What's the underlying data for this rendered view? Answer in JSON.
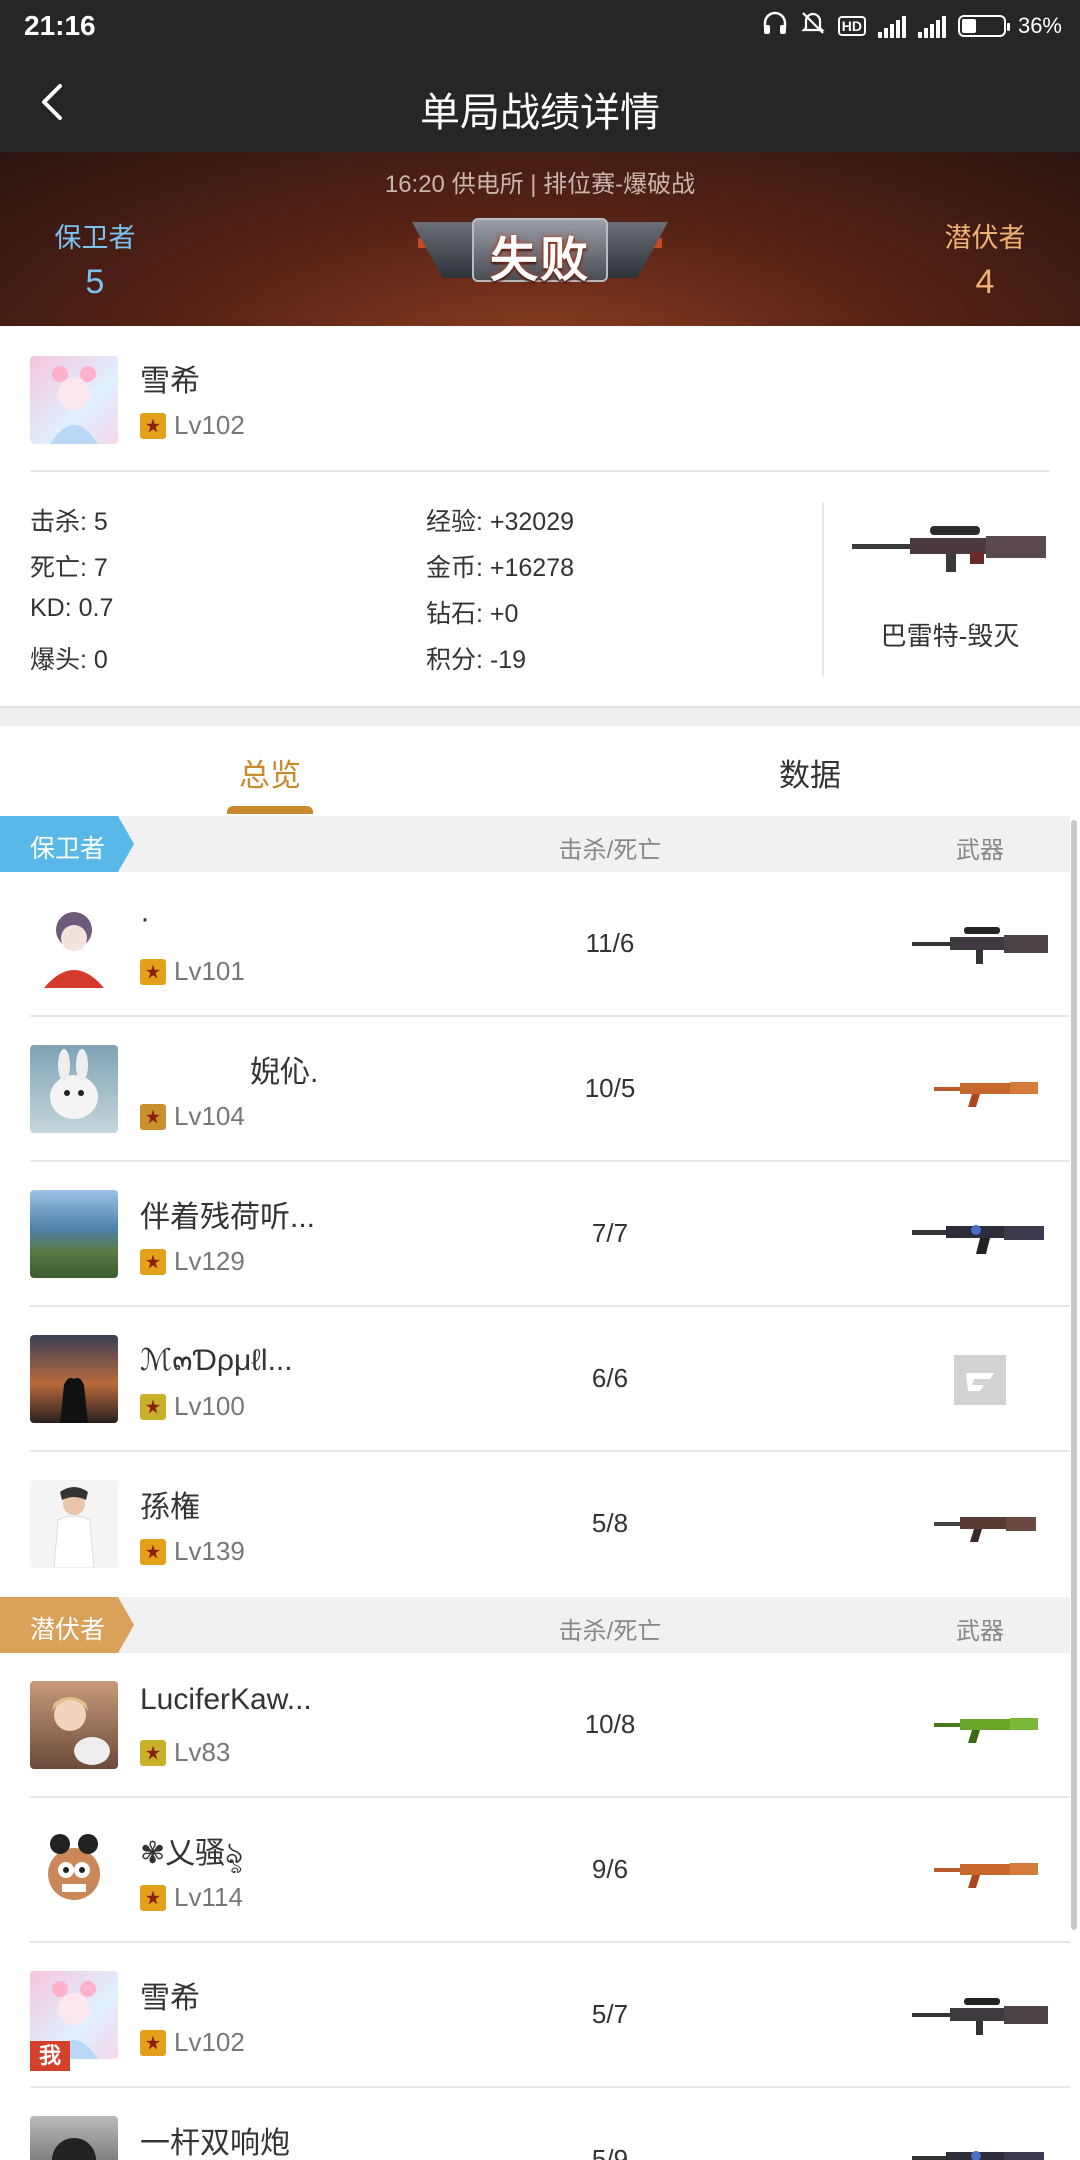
{
  "status_bar": {
    "time": "21:16",
    "network": "4G",
    "battery": "36%"
  },
  "header": {
    "title": "单局战绩详情"
  },
  "match": {
    "meta": "16:20 供电所 | 排位赛-爆破战",
    "result": "失败",
    "left_team": {
      "name": "保卫者",
      "score": "5"
    },
    "right_team": {
      "name": "潜伏者",
      "score": "4"
    }
  },
  "player": {
    "name": "雪希",
    "level": "Lv102",
    "stats": {
      "kills": "击杀: 5",
      "deaths": "死亡: 7",
      "kd": "KD: 0.7",
      "headshots": "爆头: 0",
      "exp": "经验: +32029",
      "gold": "金币: +16278",
      "diamond": "钻石: +0",
      "points": "积分: -19"
    },
    "weapon": "巴雷特-毁灭"
  },
  "tabs": [
    {
      "label": "总览"
    },
    {
      "label": "数据"
    }
  ],
  "sections": {
    "defenders": {
      "tag": "保卫者",
      "col_kd": "击杀/死亡",
      "col_weapon": "武器",
      "color": "#5ab8e8"
    },
    "attackers": {
      "tag": "潜伏者",
      "col_kd": "击杀/死亡",
      "col_weapon": "武器",
      "color": "#d9a15a"
    }
  },
  "defenders": [
    {
      "name": "·",
      "level": "Lv101",
      "kd": "11/6"
    },
    {
      "name": "婗伈.",
      "level": "Lv104",
      "kd": "10/5"
    },
    {
      "name": "伴着残荷听...",
      "level": "Lv129",
      "kd": "7/7"
    },
    {
      "name": "ℳ๓Ɗρμℓl...",
      "level": "Lv100",
      "kd": "6/6"
    },
    {
      "name": "孫権",
      "level": "Lv139",
      "kd": "5/8"
    }
  ],
  "attackers": [
    {
      "name": "LuciferKaw...",
      "level": "Lv83",
      "kd": "10/8"
    },
    {
      "name": "✾乂骚ৡ",
      "level": "Lv114",
      "kd": "9/6"
    },
    {
      "name": "雪希",
      "level": "Lv102",
      "kd": "5/7",
      "me_tag": "我"
    },
    {
      "name": "一杆双响炮",
      "level": "",
      "kd": "5/9"
    }
  ]
}
